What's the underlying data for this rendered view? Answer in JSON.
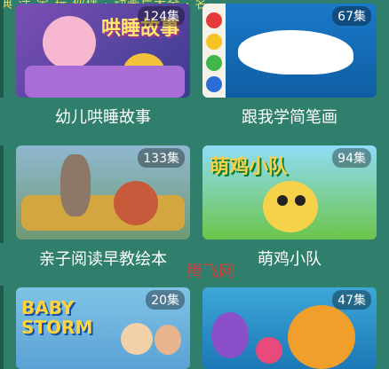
{
  "marquee_text": "典   活 宝  玩  伙伴 · 动画片大全 · 名",
  "cards": [
    {
      "title": "幼儿哄睡故事",
      "episodes": "124集",
      "art_text": "哄睡故事"
    },
    {
      "title": "跟我学简笔画",
      "episodes": "67集"
    },
    {
      "title": "亲子阅读早教绘本",
      "episodes": "133集"
    },
    {
      "title": "萌鸡小队",
      "episodes": "94集",
      "art_text": "萌鸡小队"
    },
    {
      "title": "",
      "episodes": "20集",
      "art_text": "BABY STORM"
    },
    {
      "title": "",
      "episodes": "47集"
    }
  ],
  "watermark": "腾飞网"
}
